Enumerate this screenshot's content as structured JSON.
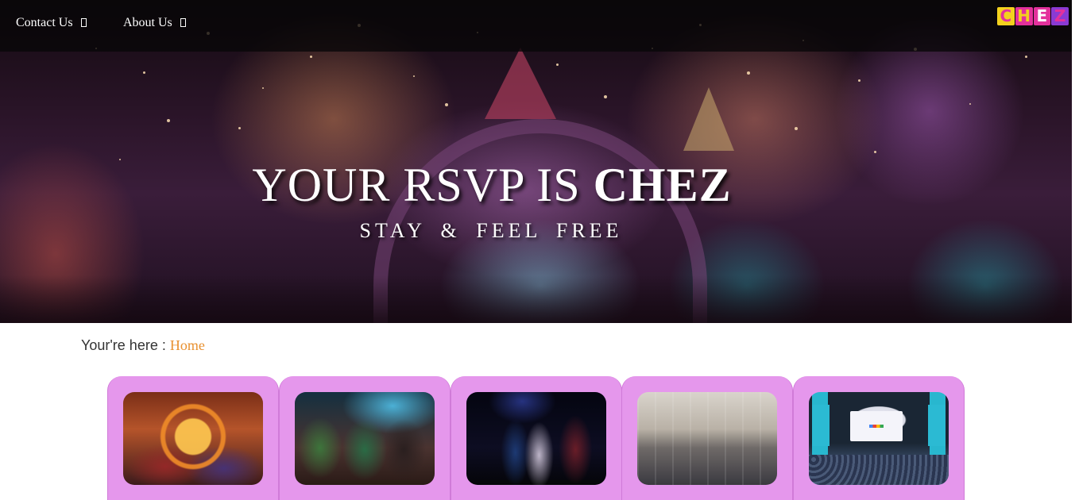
{
  "nav": {
    "items": [
      {
        "label": "Contact Us"
      },
      {
        "label": "About Us"
      }
    ],
    "logo": {
      "letters": [
        "C",
        "H",
        "E",
        "Z"
      ]
    }
  },
  "hero": {
    "title_prefix": "YOUR RSVP IS ",
    "title_emphasis": "CHEZ",
    "subtitle": "STAY & FEEL FREE"
  },
  "breadcrumb": {
    "prefix": "Your're here : ",
    "current": "Home"
  },
  "colors": {
    "accent": "#e8902f",
    "card_background": "#e597ec",
    "navbar": "#080608",
    "logo_yellow": "#f3d11e",
    "logo_pink": "#e3319c",
    "logo_purple": "#8a3ad3"
  },
  "events": [
    {
      "image": "avengers-poster"
    },
    {
      "image": "stage-dancers"
    },
    {
      "image": "singers-on-stage"
    },
    {
      "image": "conference-hall-audience"
    },
    {
      "image": "google-keynote-stage"
    }
  ]
}
